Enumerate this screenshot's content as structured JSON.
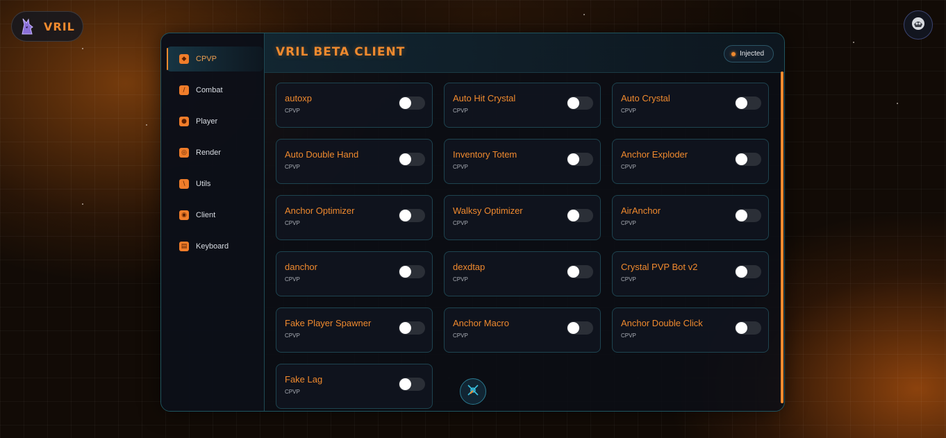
{
  "brand": {
    "name": "VRIL",
    "logo_icon": "wolf-logo-icon",
    "accent_color": "#f08a2e"
  },
  "top_right": {
    "icon": "avatar-icon"
  },
  "sidebar": {
    "items": [
      {
        "label": "CPVP",
        "icon": "crystal-icon",
        "active": true
      },
      {
        "label": "Combat",
        "icon": "sword-icon",
        "active": false
      },
      {
        "label": "Player",
        "icon": "player-icon",
        "active": false
      },
      {
        "label": "Render",
        "icon": "render-icon",
        "active": false
      },
      {
        "label": "Utils",
        "icon": "wrench-icon",
        "active": false
      },
      {
        "label": "Client",
        "icon": "client-icon",
        "active": false
      },
      {
        "label": "Keyboard",
        "icon": "keyboard-icon",
        "active": false
      }
    ]
  },
  "header": {
    "title": "VRIL BETA CLIENT",
    "status": "Injected"
  },
  "modules": [
    {
      "name": "autoxp",
      "category": "CPVP",
      "enabled": false
    },
    {
      "name": "Auto Hit Crystal",
      "category": "CPVP",
      "enabled": false
    },
    {
      "name": "Auto Crystal",
      "category": "CPVP",
      "enabled": false
    },
    {
      "name": "Auto Double Hand",
      "category": "CPVP",
      "enabled": false
    },
    {
      "name": "Inventory Totem",
      "category": "CPVP",
      "enabled": false
    },
    {
      "name": "Anchor Exploder",
      "category": "CPVP",
      "enabled": false
    },
    {
      "name": "Anchor Optimizer",
      "category": "CPVP",
      "enabled": false
    },
    {
      "name": "Walksy Optimizer",
      "category": "CPVP",
      "enabled": false
    },
    {
      "name": "AirAnchor",
      "category": "CPVP",
      "enabled": false
    },
    {
      "name": "danchor",
      "category": "CPVP",
      "enabled": false
    },
    {
      "name": "dexdtap",
      "category": "CPVP",
      "enabled": false
    },
    {
      "name": "Crystal PVP Bot v2",
      "category": "CPVP",
      "enabled": false
    },
    {
      "name": "Fake Player Spawner",
      "category": "CPVP",
      "enabled": false
    },
    {
      "name": "Anchor Macro",
      "category": "CPVP",
      "enabled": false
    },
    {
      "name": "Anchor Double Click",
      "category": "CPVP",
      "enabled": false
    },
    {
      "name": "Fake Lag",
      "category": "CPVP",
      "enabled": false
    }
  ],
  "floating_button": {
    "icon": "radar-icon"
  }
}
